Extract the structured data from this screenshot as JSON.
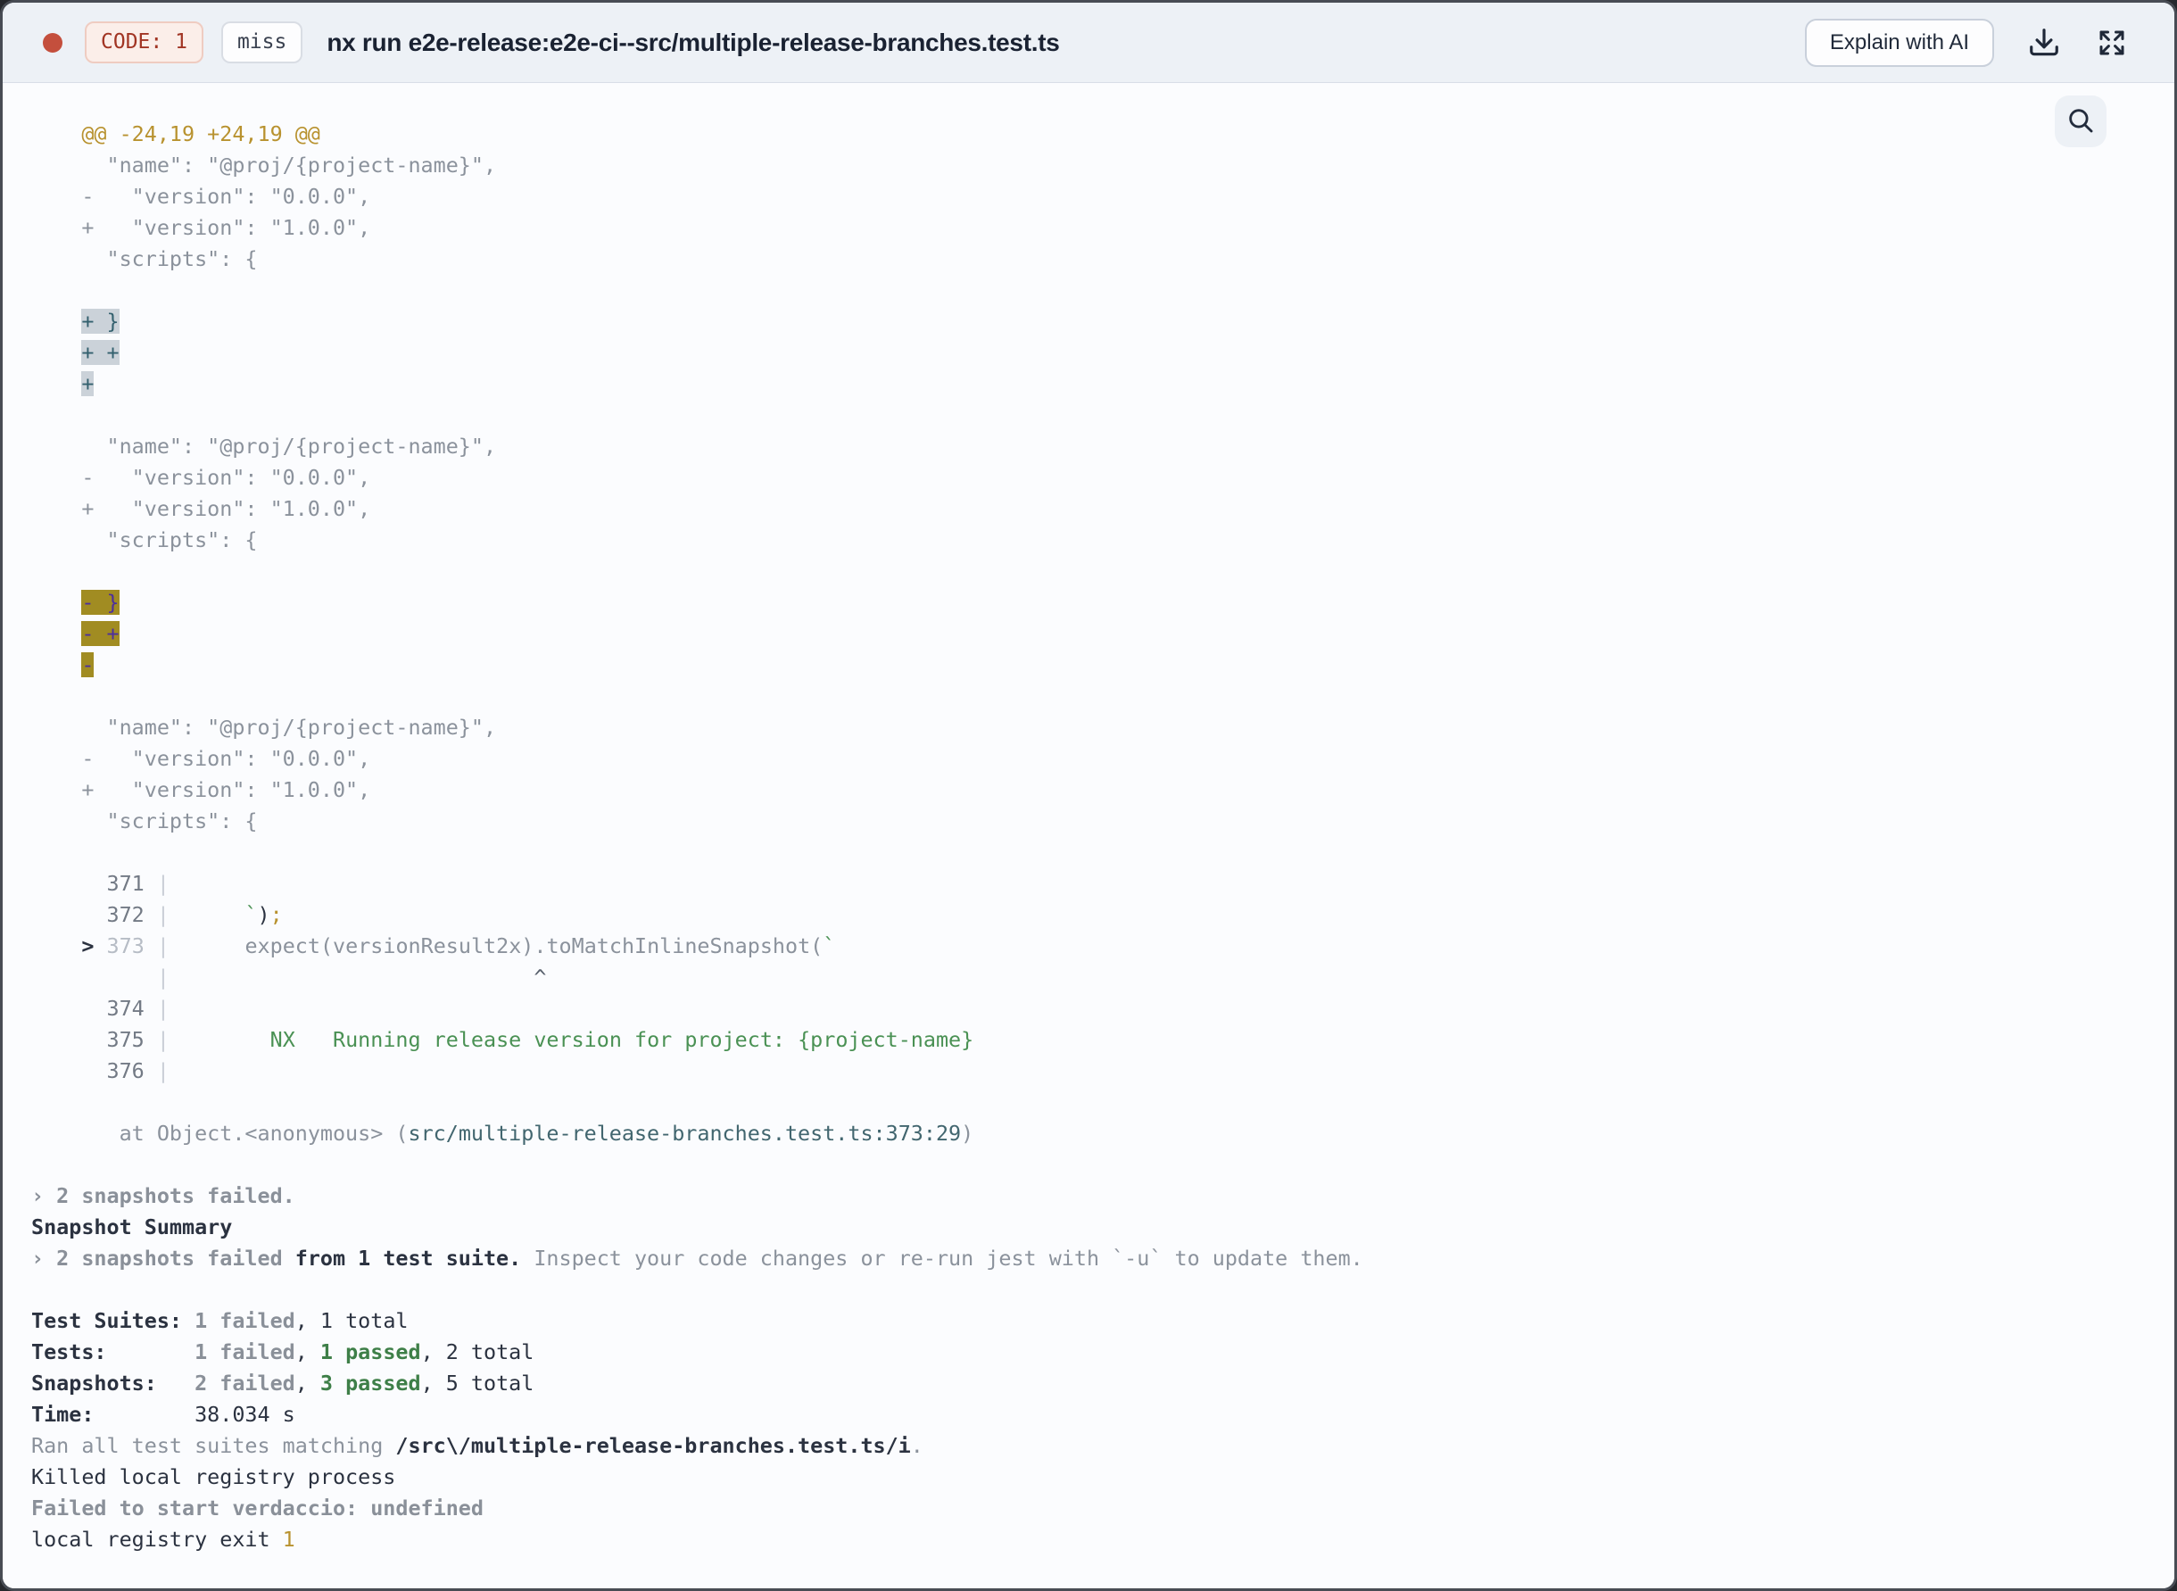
{
  "header": {
    "code_badge": "CODE: 1",
    "cache_badge": "miss",
    "title": "nx run e2e-release:e2e-ci--src/multiple-release-branches.test.ts",
    "explain_button": "Explain with AI",
    "colors": {
      "status_dot": "#c44f3d",
      "code_badge_text": "#a13524",
      "code_badge_bg": "#fbeee9",
      "header_bg": "#edf1f6",
      "title_text": "#1a2232"
    }
  },
  "terminal": {
    "colors": {
      "background": "#fbfcfe",
      "default_text": "#8b929c",
      "gold": "#b8922f",
      "dark": "#2b3240",
      "green": "#4a9154",
      "passed_green": "#3e7f48",
      "file_path_teal": "#42666f",
      "added_highlight_bg": "#cbd2d9",
      "added_highlight_text": "#33606e",
      "removed_highlight_bg": "#a18c22",
      "removed_highlight_text": "#4c2f9e"
    },
    "lines": [
      [
        {
          "t": "    @@ -24,19 +24,19 @@",
          "c": "gold"
        }
      ],
      [
        {
          "t": "      \"name\": \"@proj/{project-name}\",",
          "c": "gray"
        }
      ],
      [
        {
          "t": "    -   \"version\": \"0.0.0\",",
          "c": "gray"
        }
      ],
      [
        {
          "t": "    +   \"version\": \"1.0.0\",",
          "c": "gray"
        }
      ],
      [
        {
          "t": "      \"scripts\": {",
          "c": "gray"
        }
      ],
      [],
      [
        {
          "t": "    ",
          "c": "p"
        },
        {
          "t": "+ }",
          "c": "hla"
        }
      ],
      [
        {
          "t": "    ",
          "c": "p"
        },
        {
          "t": "+ +",
          "c": "hla"
        }
      ],
      [
        {
          "t": "    ",
          "c": "p"
        },
        {
          "t": "+",
          "c": "hla"
        }
      ],
      [],
      [
        {
          "t": "      \"name\": \"@proj/{project-name}\",",
          "c": "gray"
        }
      ],
      [
        {
          "t": "    -   \"version\": \"0.0.0\",",
          "c": "gray"
        }
      ],
      [
        {
          "t": "    +   \"version\": \"1.0.0\",",
          "c": "gray"
        }
      ],
      [
        {
          "t": "      \"scripts\": {",
          "c": "gray"
        }
      ],
      [],
      [
        {
          "t": "    ",
          "c": "p"
        },
        {
          "t": "- }",
          "c": "hld"
        }
      ],
      [
        {
          "t": "    ",
          "c": "p"
        },
        {
          "t": "- +",
          "c": "hld"
        }
      ],
      [
        {
          "t": "    ",
          "c": "p"
        },
        {
          "t": "-",
          "c": "hld"
        }
      ],
      [],
      [
        {
          "t": "      \"name\": \"@proj/{project-name}\",",
          "c": "gray"
        }
      ],
      [
        {
          "t": "    -   \"version\": \"0.0.0\",",
          "c": "gray"
        }
      ],
      [
        {
          "t": "    +   \"version\": \"1.0.0\",",
          "c": "gray"
        }
      ],
      [
        {
          "t": "      \"scripts\": {",
          "c": "gray"
        }
      ],
      [],
      [
        {
          "t": "      ",
          "c": "p"
        },
        {
          "t": "371",
          "c": "num"
        },
        {
          "t": " ",
          "c": "p"
        },
        {
          "t": "|",
          "c": "pipe"
        }
      ],
      [
        {
          "t": "      ",
          "c": "p"
        },
        {
          "t": "372",
          "c": "num"
        },
        {
          "t": " ",
          "c": "p"
        },
        {
          "t": "|",
          "c": "pipe"
        },
        {
          "t": "      ",
          "c": "p"
        },
        {
          "t": "`",
          "c": "green"
        },
        {
          "t": ")",
          "c": "dark"
        },
        {
          "t": ";",
          "c": "gold"
        }
      ],
      [
        {
          "t": "    ",
          "c": "p"
        },
        {
          "t": ">",
          "c": "mark"
        },
        {
          "t": " ",
          "c": "p"
        },
        {
          "t": "373",
          "c": "dim"
        },
        {
          "t": " ",
          "c": "p"
        },
        {
          "t": "|",
          "c": "pipe"
        },
        {
          "t": "      ",
          "c": "p"
        },
        {
          "t": "expect(versionResult2x).toMatchInlineSnapshot(",
          "c": "gray"
        },
        {
          "t": "`",
          "c": "green"
        }
      ],
      [
        {
          "t": "          ",
          "c": "p"
        },
        {
          "t": "|",
          "c": "pipe"
        },
        {
          "t": "                             ",
          "c": "p"
        },
        {
          "t": "^",
          "c": "caret"
        }
      ],
      [
        {
          "t": "      ",
          "c": "p"
        },
        {
          "t": "374",
          "c": "num"
        },
        {
          "t": " ",
          "c": "p"
        },
        {
          "t": "|",
          "c": "pipe"
        }
      ],
      [
        {
          "t": "      ",
          "c": "p"
        },
        {
          "t": "375",
          "c": "num"
        },
        {
          "t": " ",
          "c": "p"
        },
        {
          "t": "|",
          "c": "pipe"
        },
        {
          "t": "        ",
          "c": "p"
        },
        {
          "t": "NX   Running release version for project: {project-name}",
          "c": "green"
        }
      ],
      [
        {
          "t": "      ",
          "c": "p"
        },
        {
          "t": "376",
          "c": "num"
        },
        {
          "t": " ",
          "c": "p"
        },
        {
          "t": "|",
          "c": "pipe"
        }
      ],
      [],
      [
        {
          "t": "       ",
          "c": "p"
        },
        {
          "t": "at Object.<anonymous> (",
          "c": "gray"
        },
        {
          "t": "src/multiple-release-branches.test.ts:373:29",
          "c": "teal"
        },
        {
          "t": ")",
          "c": "gray"
        }
      ],
      [],
      [
        {
          "t": "› 2 snapshots failed.",
          "c": "bgray"
        }
      ],
      [
        {
          "t": "Snapshot Summary",
          "c": "bdark"
        }
      ],
      [
        {
          "t": "› 2 snapshots failed",
          "c": "bgray"
        },
        {
          "t": " from 1 test suite.",
          "c": "bdark"
        },
        {
          "t": " Inspect your code changes or re-run jest with `-u` to update them.",
          "c": "gray"
        }
      ],
      [],
      [
        {
          "t": "Test Suites: ",
          "c": "bdark"
        },
        {
          "t": "1 failed",
          "c": "bgray"
        },
        {
          "t": ", ",
          "c": "dark"
        },
        {
          "t": "1 total",
          "c": "dark"
        }
      ],
      [
        {
          "t": "Tests:       ",
          "c": "bdark"
        },
        {
          "t": "1 failed",
          "c": "bgray"
        },
        {
          "t": ", ",
          "c": "dark"
        },
        {
          "t": "1 passed",
          "c": "bgreen"
        },
        {
          "t": ", ",
          "c": "dark"
        },
        {
          "t": "2 total",
          "c": "dark"
        }
      ],
      [
        {
          "t": "Snapshots:   ",
          "c": "bdark"
        },
        {
          "t": "2 failed",
          "c": "bgray"
        },
        {
          "t": ", ",
          "c": "dark"
        },
        {
          "t": "3 passed",
          "c": "bgreen"
        },
        {
          "t": ", ",
          "c": "dark"
        },
        {
          "t": "5 total",
          "c": "dark"
        }
      ],
      [
        {
          "t": "Time:        ",
          "c": "bdark"
        },
        {
          "t": "38.034 s",
          "c": "dark"
        }
      ],
      [
        {
          "t": "Ran all test suites matching ",
          "c": "gray"
        },
        {
          "t": "/src\\/multiple-release-branches.test.ts/i",
          "c": "bdark"
        },
        {
          "t": ".",
          "c": "gray"
        }
      ],
      [
        {
          "t": "Killed local registry process",
          "c": "dark"
        }
      ],
      [
        {
          "t": "Failed to start verdaccio: undefined",
          "c": "bgray"
        }
      ],
      [
        {
          "t": "local registry exit ",
          "c": "dark"
        },
        {
          "t": "1",
          "c": "gold"
        }
      ]
    ]
  }
}
